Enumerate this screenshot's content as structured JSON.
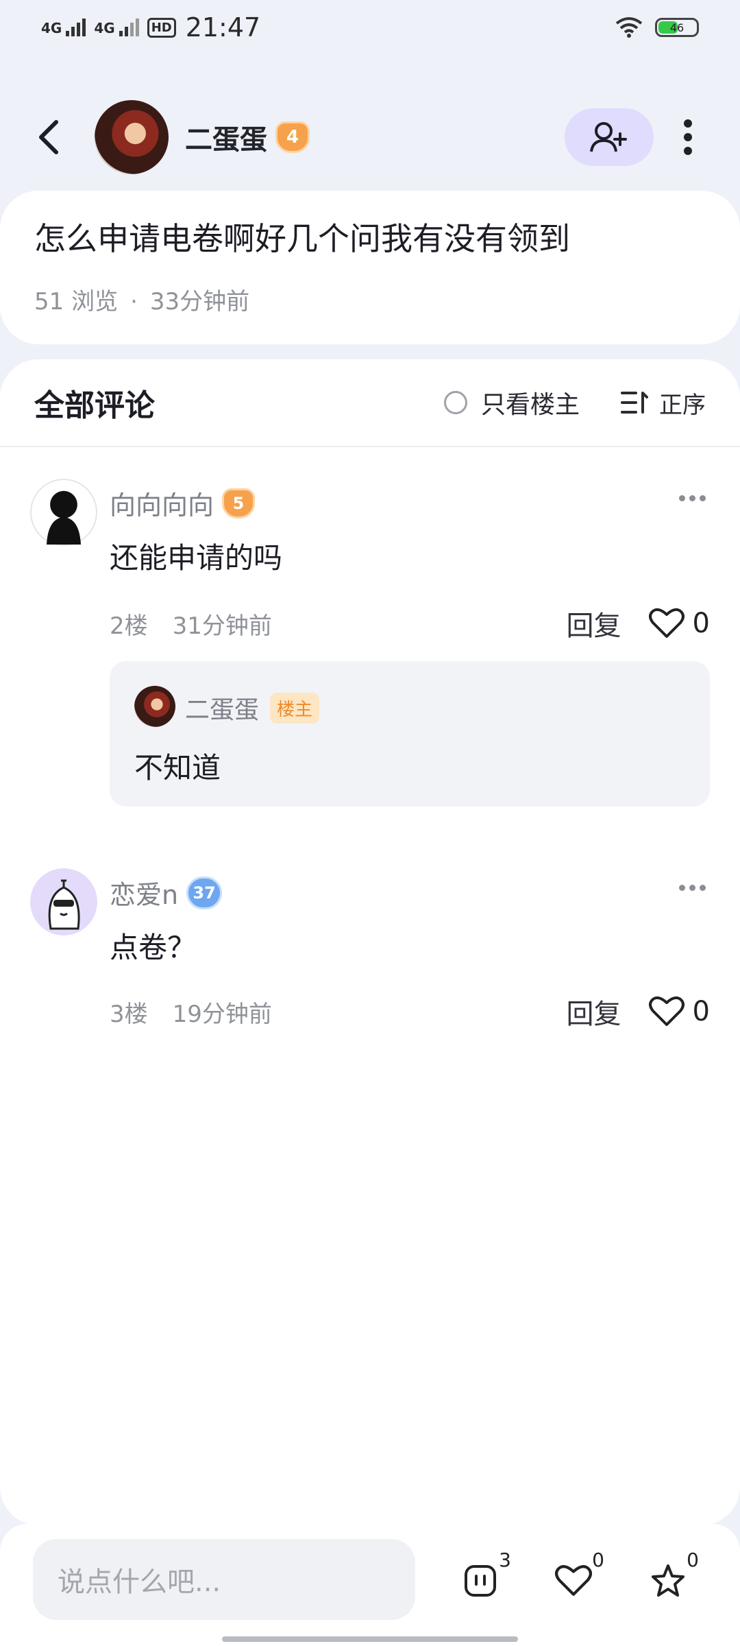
{
  "status": {
    "net1": "4G",
    "net2": "4G",
    "hd": "HD",
    "time": "21:47",
    "battery": "46"
  },
  "header": {
    "author": "二蛋蛋",
    "level": "4"
  },
  "post": {
    "title": "怎么申请电卷啊好几个问我有没有领到",
    "views": "51 浏览",
    "dot": "·",
    "time": "33分钟前"
  },
  "comments_header": {
    "title": "全部评论",
    "only_author": "只看楼主",
    "order": "正序"
  },
  "comments": [
    {
      "name": "向向向向",
      "level": "5",
      "text": "还能申请的吗",
      "floor": "2楼",
      "time": "31分钟前",
      "reply": "回复",
      "likes": "0",
      "sub_reply": {
        "name": "二蛋蛋",
        "badge": "楼主",
        "text": "不知道"
      }
    },
    {
      "name": "恋爱n",
      "level": "37",
      "text": "点卷？",
      "floor": "3楼",
      "time": "19分钟前",
      "reply": "回复",
      "likes": "0"
    }
  ],
  "bottom": {
    "placeholder": "说点什么吧...",
    "comment_count": "3",
    "like_count": "0",
    "fav_count": "0"
  },
  "colors": {
    "accent_bg": "#e0dcfd",
    "level_orange": "#f6a14b",
    "level_blue": "#6ea6f0",
    "badge_text": "#f08a2a",
    "badge_bg": "#fde6c4"
  }
}
